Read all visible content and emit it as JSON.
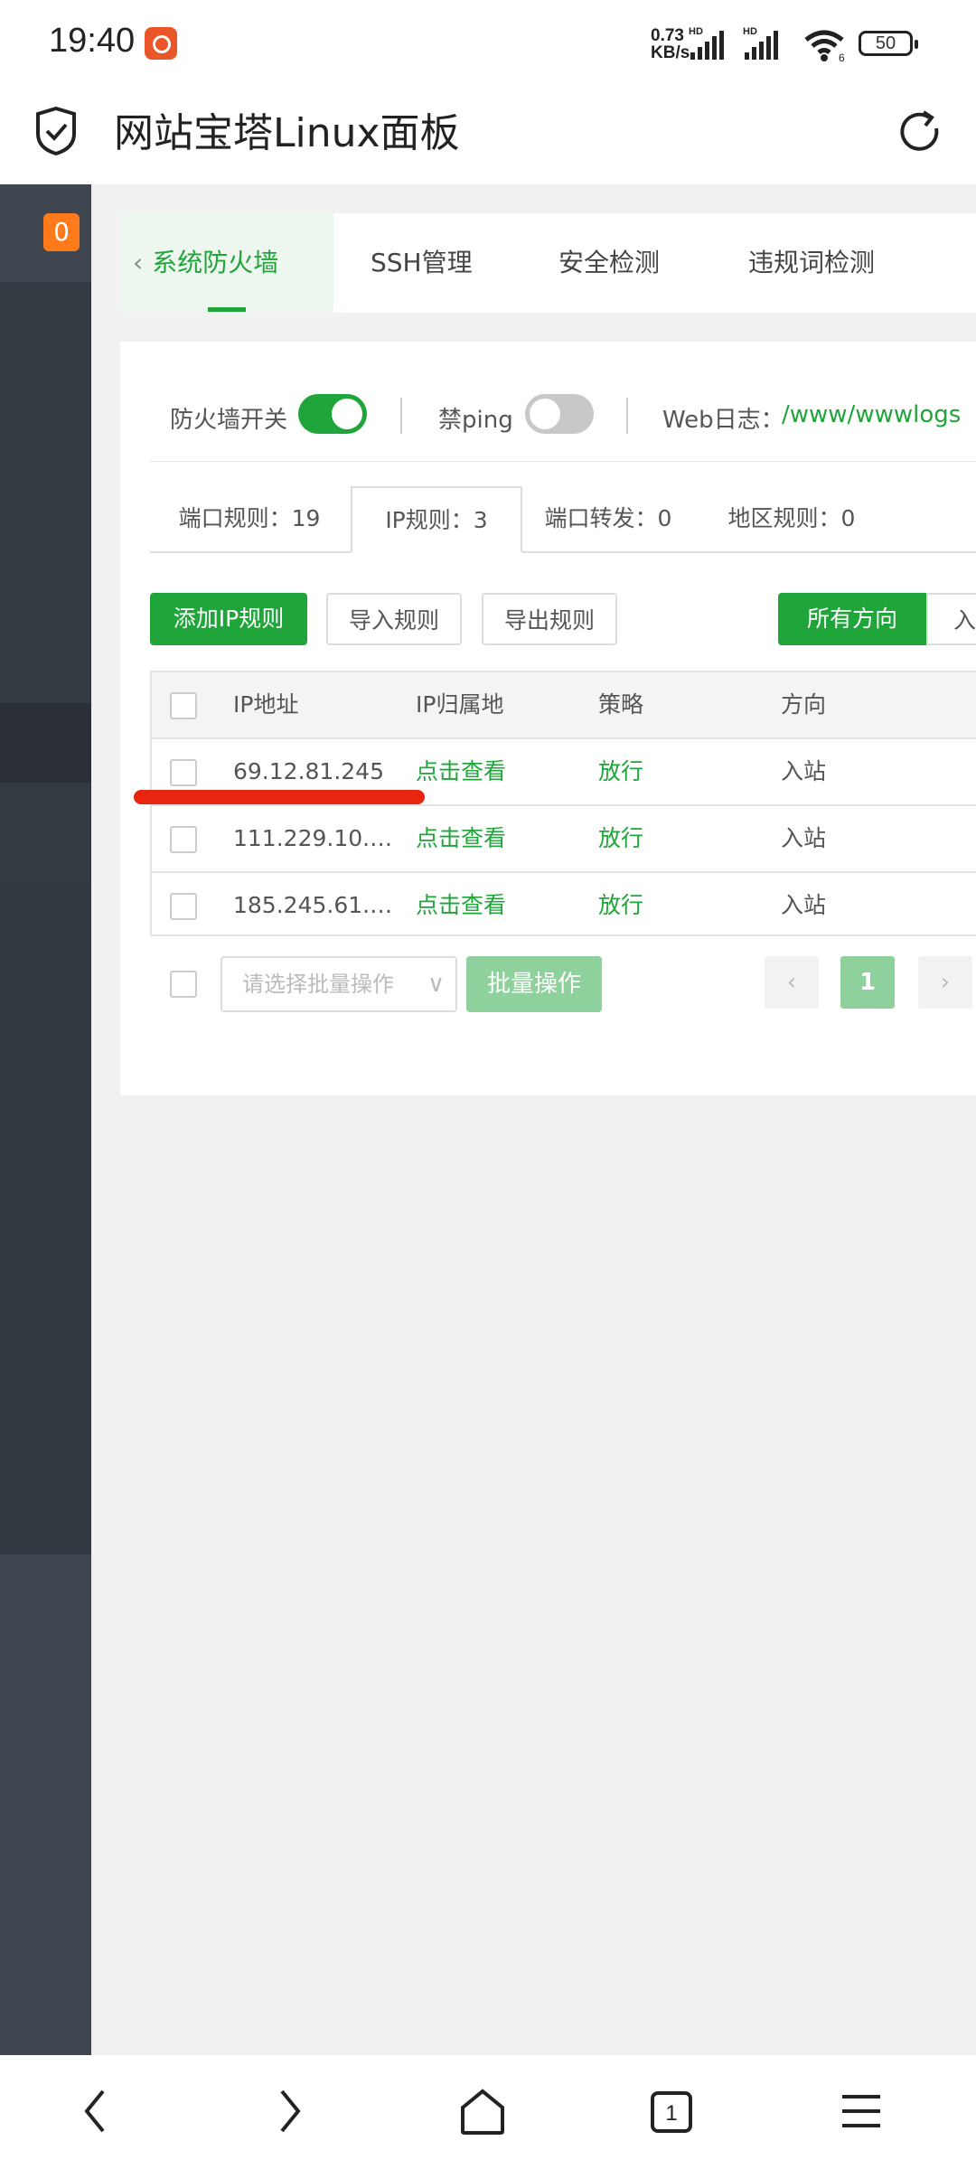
{
  "status": {
    "time": "19:40",
    "speed_top": "0.73",
    "speed_bottom": "KB/s",
    "battery": "50",
    "hd": "HD",
    "sim": "6"
  },
  "browser": {
    "title": "网站宝塔Linux面板"
  },
  "sidebar": {
    "badge": "0"
  },
  "tabs": [
    {
      "label": "系统防火墙"
    },
    {
      "label": "SSH管理"
    },
    {
      "label": "安全检测"
    },
    {
      "label": "违规词检测"
    }
  ],
  "firewall": {
    "switch_label": "防火墙开关",
    "switch_on": true,
    "ping_label": "禁ping",
    "ping_on": false,
    "weblog_label": "Web日志：",
    "weblog_path": "/www/wwwlogs"
  },
  "subtabs": [
    {
      "label": "端口规则：19"
    },
    {
      "label": "IP规则：3"
    },
    {
      "label": "端口转发：0"
    },
    {
      "label": "地区规则：0"
    }
  ],
  "actions": {
    "add": "添加IP规则",
    "import": "导入规则",
    "export": "导出规则",
    "all_directions": "所有方向",
    "inbound_partial": "入"
  },
  "table": {
    "headers": [
      "IP地址",
      "IP归属地",
      "策略",
      "方向"
    ],
    "rows": [
      {
        "ip": "69.12.81.245",
        "location": "点击查看",
        "policy": "放行",
        "direction": "入站"
      },
      {
        "ip": "111.229.10.…",
        "location": "点击查看",
        "policy": "放行",
        "direction": "入站"
      },
      {
        "ip": "185.245.61.…",
        "location": "点击查看",
        "policy": "放行",
        "direction": "入站"
      }
    ]
  },
  "batch": {
    "placeholder": "请选择批量操作",
    "button": "批量操作"
  },
  "pagination": {
    "current": "1"
  },
  "colors": {
    "accent": "#20a53a",
    "sidebar": "#3b424b",
    "badge": "#ff7a1a",
    "annotation": "#e8250f"
  }
}
